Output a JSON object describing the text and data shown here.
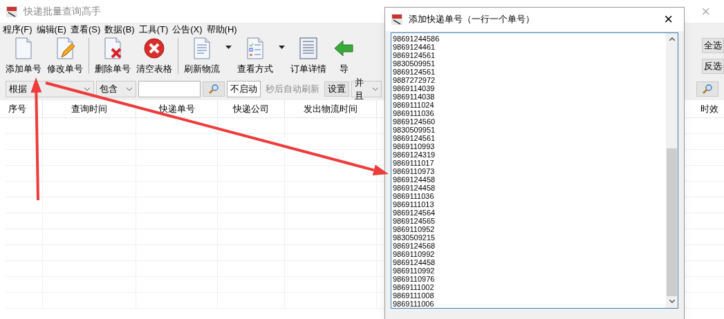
{
  "main_window": {
    "title": "快递批量查询高手"
  },
  "menu": [
    "程序(F)",
    "编辑(E)",
    "查看(S)",
    "数据(B)",
    "工具(T)",
    "公告(X)",
    "帮助(H)"
  ],
  "toolbar": [
    {
      "kind": "add",
      "label": "添加单号",
      "dropdown": false
    },
    {
      "kind": "edit",
      "label": "修改单号",
      "dropdown": false
    },
    {
      "kind": "separator"
    },
    {
      "kind": "delete",
      "label": "删除单号",
      "dropdown": false
    },
    {
      "kind": "clear",
      "label": "清空表格",
      "dropdown": false
    },
    {
      "kind": "separator"
    },
    {
      "kind": "refresh",
      "label": "刷新物流",
      "dropdown": true
    },
    {
      "kind": "view",
      "label": "查看方式",
      "dropdown": true
    },
    {
      "kind": "detail",
      "label": "订单详情",
      "dropdown": false
    },
    {
      "kind": "export",
      "label": "导",
      "dropdown": false
    }
  ],
  "side_buttons": [
    "全选",
    "反选"
  ],
  "filter": {
    "field_combo": "根据",
    "match_combo": "包含",
    "refresh_value": "不启动",
    "refresh_label": "秒后自动刷新",
    "settings_button": "设置",
    "logic_combo": "并且"
  },
  "table": {
    "columns": [
      "序号",
      "查询时间",
      "快递单号",
      "快递公司",
      "发出物流时间"
    ],
    "last_column": "时效"
  },
  "dialog": {
    "title": "添加快递单号（一行一个单号）",
    "close": "×",
    "numbers": [
      "98691244586",
      "9869124461",
      "9869124561",
      "9830509951",
      "9869124561",
      "9887272972",
      "9869114039",
      "9869114038",
      "9869111024",
      "9869111036",
      "9869124560",
      "9830509951",
      "9869124561",
      "9869110993",
      "9869124319",
      "9869111017",
      "9869110973",
      "9869124458",
      "9869124458",
      "9869111036",
      "9869111013",
      "9869124564",
      "9869124565",
      "9869110952",
      "9830509215",
      "9869124568",
      "9869110992",
      "9869124458",
      "9869110992",
      "9869110976",
      "9869111002",
      "9869111008",
      "9869111006"
    ]
  },
  "main_close": "×"
}
